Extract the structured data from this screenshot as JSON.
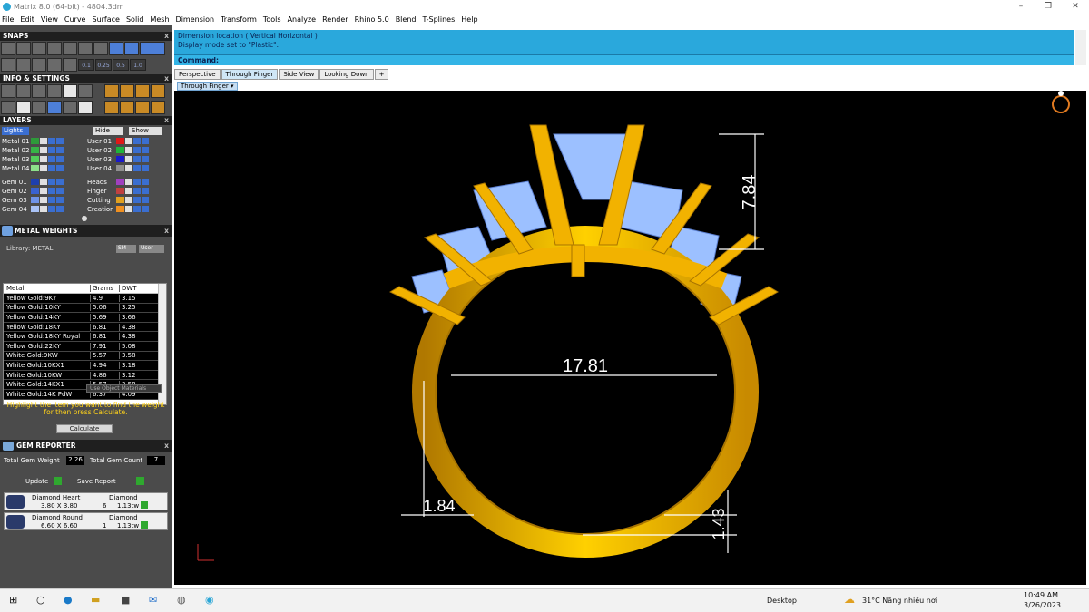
{
  "window": {
    "title": "Matrix 8.0 (64-bit) - 4804.3dm"
  },
  "menu": [
    "File",
    "Edit",
    "View",
    "Curve",
    "Surface",
    "Solid",
    "Mesh",
    "Dimension",
    "Transform",
    "Tools",
    "Analyze",
    "Render",
    "Rhino 5.0",
    "Blend",
    "T-Splines",
    "Help"
  ],
  "panels": {
    "snaps_title": "SNAPS",
    "snap_values": [
      "0.1",
      "0.25",
      "0.5",
      "1.0"
    ],
    "info_title": "INFO & SETTINGS",
    "layers_title": "LAYERS",
    "lights_label": "Lights",
    "hide_label": "Hide",
    "show_label": "Show",
    "layers_left": [
      {
        "name": "Metal 01",
        "color": "#2e9a3a"
      },
      {
        "name": "Metal 02",
        "color": "#37b347"
      },
      {
        "name": "Metal 03",
        "color": "#52cc5a"
      },
      {
        "name": "Metal 04",
        "color": "#8de08a"
      },
      {
        "name": "Gem 01",
        "color": "#1e3fae"
      },
      {
        "name": "Gem 02",
        "color": "#3a62d0"
      },
      {
        "name": "Gem 03",
        "color": "#6f93e8"
      },
      {
        "name": "Gem 04",
        "color": "#a9c2f5"
      }
    ],
    "layers_right": [
      {
        "name": "User 01",
        "color": "#e01818"
      },
      {
        "name": "User 02",
        "color": "#1fb43a"
      },
      {
        "name": "User 03",
        "color": "#1a1acc"
      },
      {
        "name": "User 04",
        "color": "#909090"
      },
      {
        "name": "Heads",
        "color": "#a040c0"
      },
      {
        "name": "Finger",
        "color": "#c04040"
      },
      {
        "name": "Cutting",
        "color": "#e0a020"
      },
      {
        "name": "Creation",
        "color": "#f09020"
      }
    ]
  },
  "metal_weights": {
    "title": "METAL WEIGHTS",
    "library_label": "Library: METAL",
    "sm_label": "SM",
    "user_label": "User",
    "columns": [
      "Metal",
      "Grams",
      "DWT"
    ],
    "rows": [
      [
        "Yellow Gold:9KY",
        "4.9",
        "3.15"
      ],
      [
        "Yellow Gold:10KY",
        "5.06",
        "3.25"
      ],
      [
        "Yellow Gold:14KY",
        "5.69",
        "3.66"
      ],
      [
        "Yellow Gold:18KY",
        "6.81",
        "4.38"
      ],
      [
        "Yellow Gold:18KY Royal",
        "6.81",
        "4.38"
      ],
      [
        "Yellow Gold:22KY",
        "7.91",
        "5.08"
      ],
      [
        "White Gold:9KW",
        "5.57",
        "3.58"
      ],
      [
        "White Gold:10KX1",
        "4.94",
        "3.18"
      ],
      [
        "White Gold:10KW",
        "4.86",
        "3.12"
      ],
      [
        "White Gold:14KX1",
        "5.57",
        "3.58"
      ],
      [
        "White Gold:14K PdW",
        "6.37",
        "4.09"
      ]
    ],
    "use_object_materials": "Use Object Materials",
    "hint_line1": "Highlight the item you want to find the weight",
    "hint_line2": "for then press Calculate.",
    "calculate_label": "Calculate"
  },
  "gem_reporter": {
    "title": "GEM REPORTER",
    "total_weight_label": "Total Gem Weight",
    "total_weight_value": "2.26",
    "total_count_label": "Total Gem Count",
    "total_count_value": "7",
    "update_label": "Update",
    "save_report_label": "Save Report",
    "gems": [
      {
        "name": "Diamond Heart",
        "size": "3.80 X 3.80",
        "type": "Diamond",
        "count": "6",
        "weight": "1.13tw"
      },
      {
        "name": "Diamond Round",
        "size": "6.60 X 6.60",
        "type": "Diamond",
        "count": "1",
        "weight": "1.13tw"
      }
    ]
  },
  "command": {
    "history_line1": "Dimension location ( Vertical  Horizontal )",
    "history_line2": "Display mode set to \"Plastic\".",
    "prompt": "Command:"
  },
  "viewport_tabs": [
    "Perspective",
    "Through Finger",
    "Side View",
    "Looking Down"
  ],
  "active_viewport": "Through Finger",
  "dimensions": {
    "width": "17.81",
    "height": "7.84",
    "shank": "1.84",
    "bottom": "1.43"
  },
  "colors": {
    "metal": "#f2b200",
    "metal_dark": "#a87400",
    "gem": "#9cc0ff",
    "dim": "#ffffff",
    "panel": "#4b4b4b",
    "accent": "#2aa8dc"
  },
  "taskbar": {
    "desktop_label": "Desktop",
    "weather": "31°C  Nắng nhiều nơi",
    "time": "10:49 AM",
    "date": "3/26/2023"
  }
}
